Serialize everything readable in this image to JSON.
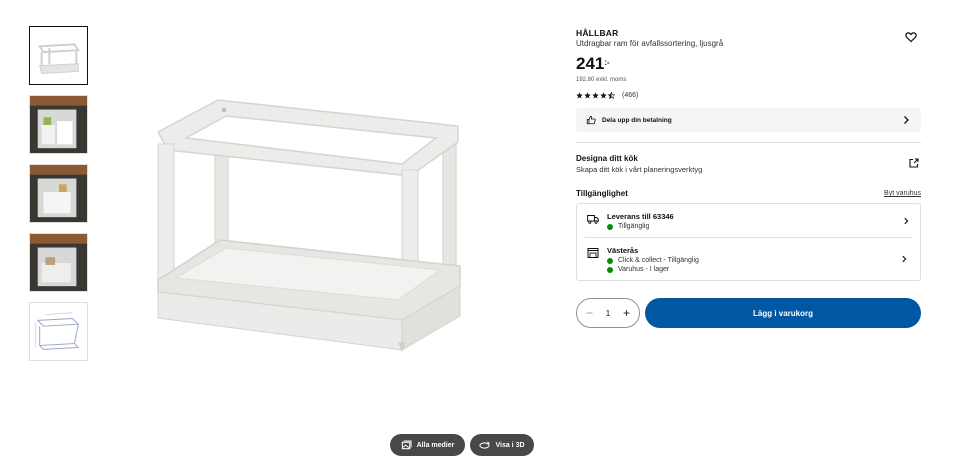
{
  "gallery": {
    "thumbnails": [
      "product-frame",
      "kitchen-cabinet-1",
      "kitchen-cabinet-2",
      "kitchen-cabinet-3",
      "dimension-drawing"
    ],
    "all_media_label": "Alla medier",
    "view_3d_label": "Visa i 3D"
  },
  "product": {
    "brand": "HÅLLBAR",
    "description": "Utdragbar ram för avfallssortering, ljusgrå",
    "price": "241",
    "price_suffix": ":-",
    "price_excl": "192,80 exkl. moms",
    "rating": 4.5,
    "review_count": "(466)"
  },
  "payment": {
    "label": "Dela upp din betalning"
  },
  "design": {
    "title": "Designa ditt kök",
    "subtitle": "Skapa ditt kök i vårt planeringsverktyg"
  },
  "availability": {
    "title": "Tillgänglighet",
    "change_store": "Byt varuhus",
    "delivery": {
      "title": "Leverans till 63346",
      "status": "Tillgänglig"
    },
    "store": {
      "title": "Västerås",
      "click_collect": "Click & collect - Tillgänglig",
      "in_store": "Varuhus - I lager"
    }
  },
  "cart": {
    "quantity": "1",
    "minus": "−",
    "plus": "+",
    "add_label": "Lägg i varukorg"
  },
  "colors": {
    "accent": "#0058a3",
    "available": "#0a8a00"
  }
}
